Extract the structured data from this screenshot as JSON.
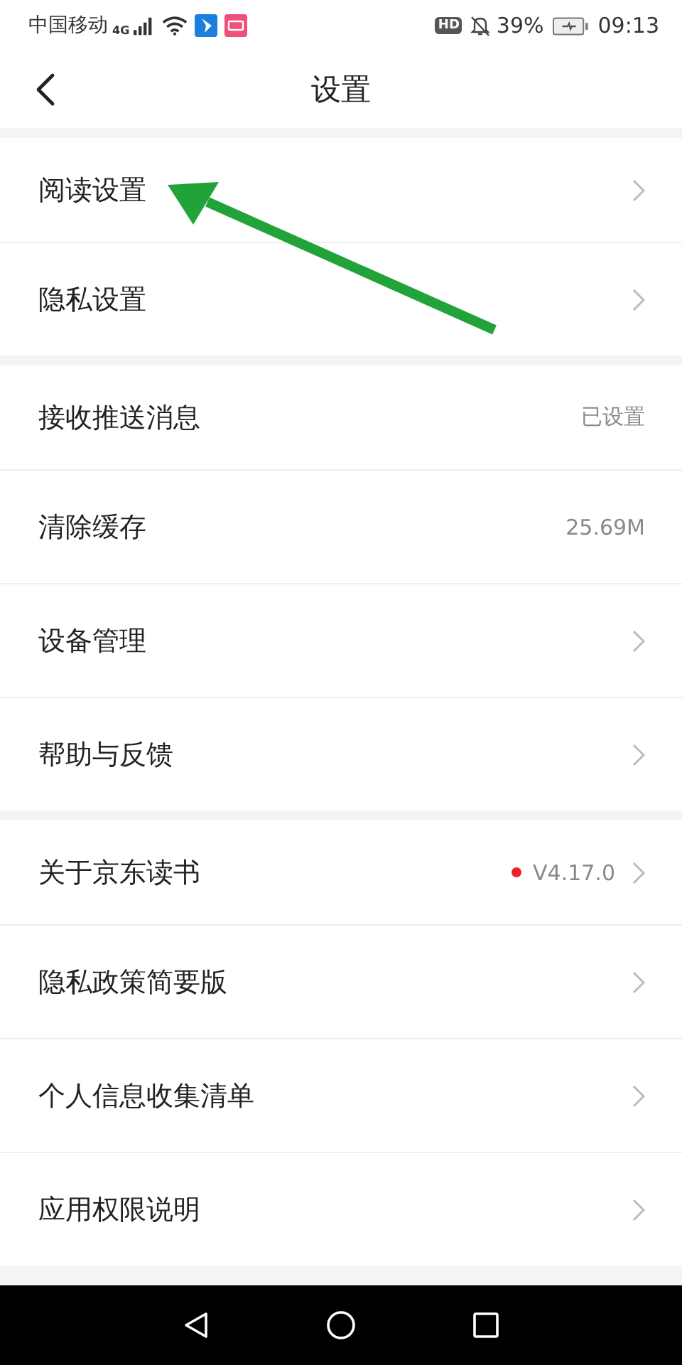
{
  "status_bar": {
    "carrier": "中国移动",
    "network": "4G",
    "hd": "HD",
    "battery": "39%",
    "time": "09:13"
  },
  "header": {
    "title": "设置"
  },
  "groups": [
    {
      "rows": [
        {
          "label": "阅读设置",
          "chevron": true
        },
        {
          "label": "隐私设置",
          "chevron": true
        }
      ]
    },
    {
      "rows": [
        {
          "label": "接收推送消息",
          "value": "已设置",
          "chevron": false
        },
        {
          "label": "清除缓存",
          "value": "25.69M",
          "chevron": false
        },
        {
          "label": "设备管理",
          "chevron": true
        },
        {
          "label": "帮助与反馈",
          "chevron": true
        }
      ]
    },
    {
      "rows": [
        {
          "label": "关于京东读书",
          "value": "V4.17.0",
          "dot": true,
          "chevron": true
        },
        {
          "label": "隐私政策简要版",
          "chevron": true
        },
        {
          "label": "个人信息收集清单",
          "chevron": true
        },
        {
          "label": "应用权限说明",
          "chevron": true
        }
      ]
    }
  ]
}
